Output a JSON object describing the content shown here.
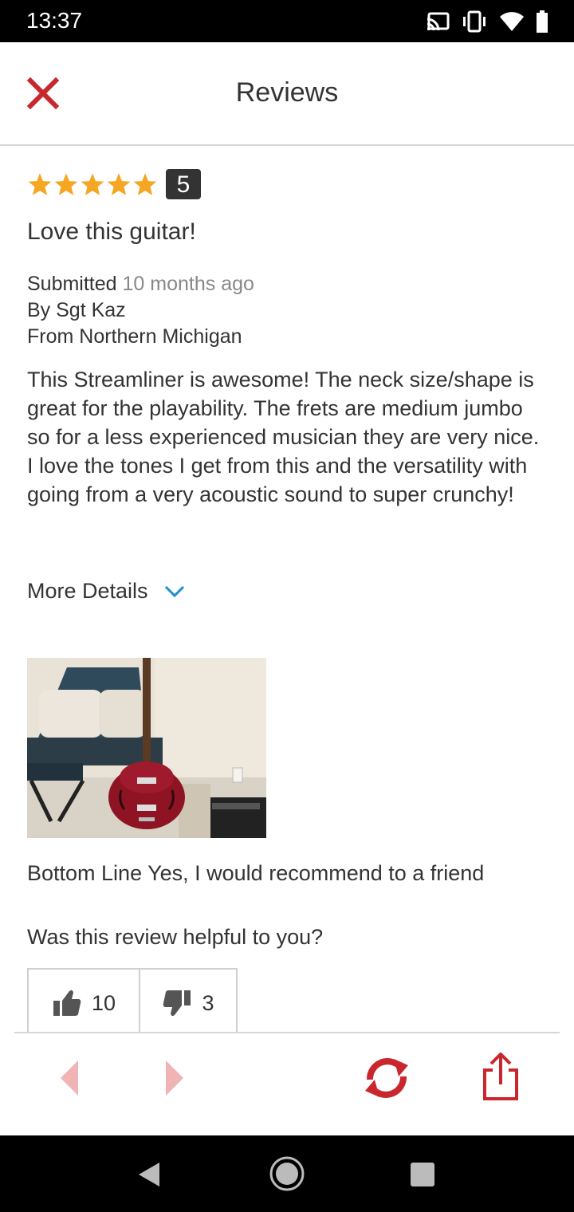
{
  "status_bar": {
    "time": "13:37",
    "icons": [
      "cast-icon",
      "vibrate-icon",
      "wifi-icon",
      "battery-icon"
    ]
  },
  "header": {
    "title": "Reviews",
    "close_icon": "close-icon"
  },
  "review": {
    "stars": 5,
    "rating_badge": "5",
    "title": "Love this guitar!",
    "submitted_label": "Submitted",
    "submitted_when": "10 months ago",
    "by_line": "By Sgt Kaz",
    "from_line": "From Northern Michigan",
    "body": "This Streamliner is awesome! The neck size/shape is great for the playability. The frets are medium jumbo so for a less experienced musician they are very nice. I love the tones I get from this and the versatility with going from a very acoustic sound to super crunchy!",
    "more_details_label": "More Details",
    "bottom_line": "Bottom Line Yes, I would recommend to a friend",
    "helpful_question": "Was this review helpful to you?",
    "helpful_yes_count": "10",
    "helpful_no_count": "3"
  },
  "colors": {
    "accent_red": "#c8272d",
    "arrow_disabled": "#f0b4b4",
    "star": "#f5a623",
    "chevron": "#1a8fc9"
  },
  "toolbar": {
    "icons": [
      "prev-arrow-icon",
      "next-arrow-icon",
      "refresh-icon",
      "share-icon"
    ]
  }
}
